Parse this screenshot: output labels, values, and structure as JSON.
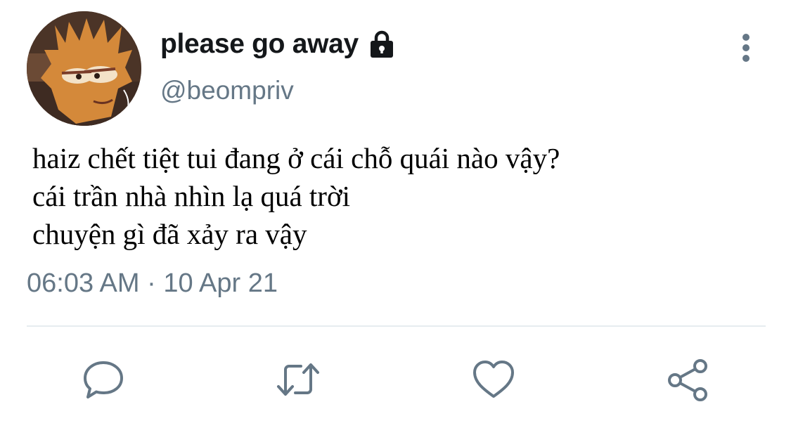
{
  "user": {
    "display_name": "please go away",
    "handle": "@beompriv",
    "avatar": "avatar-image",
    "protected_icon": "lock-icon"
  },
  "menu": {
    "icon": "more-vertical-icon"
  },
  "tweet": {
    "lines": [
      "haiz chết tiệt tui đang ở cái chỗ quái nào vậy?",
      "cái trần nhà nhìn lạ quá trời",
      "chuyện gì đã xảy ra vậy"
    ],
    "timestamp": "06:03 AM · 10 Apr 21"
  },
  "actions": [
    {
      "icon": "reply-icon"
    },
    {
      "icon": "retweet-icon"
    },
    {
      "icon": "like-icon"
    },
    {
      "icon": "share-icon"
    }
  ],
  "colors": {
    "primary_text": "#14171a",
    "secondary_text": "#657786",
    "icon": "#657786",
    "divider": "#e6ecf0"
  }
}
